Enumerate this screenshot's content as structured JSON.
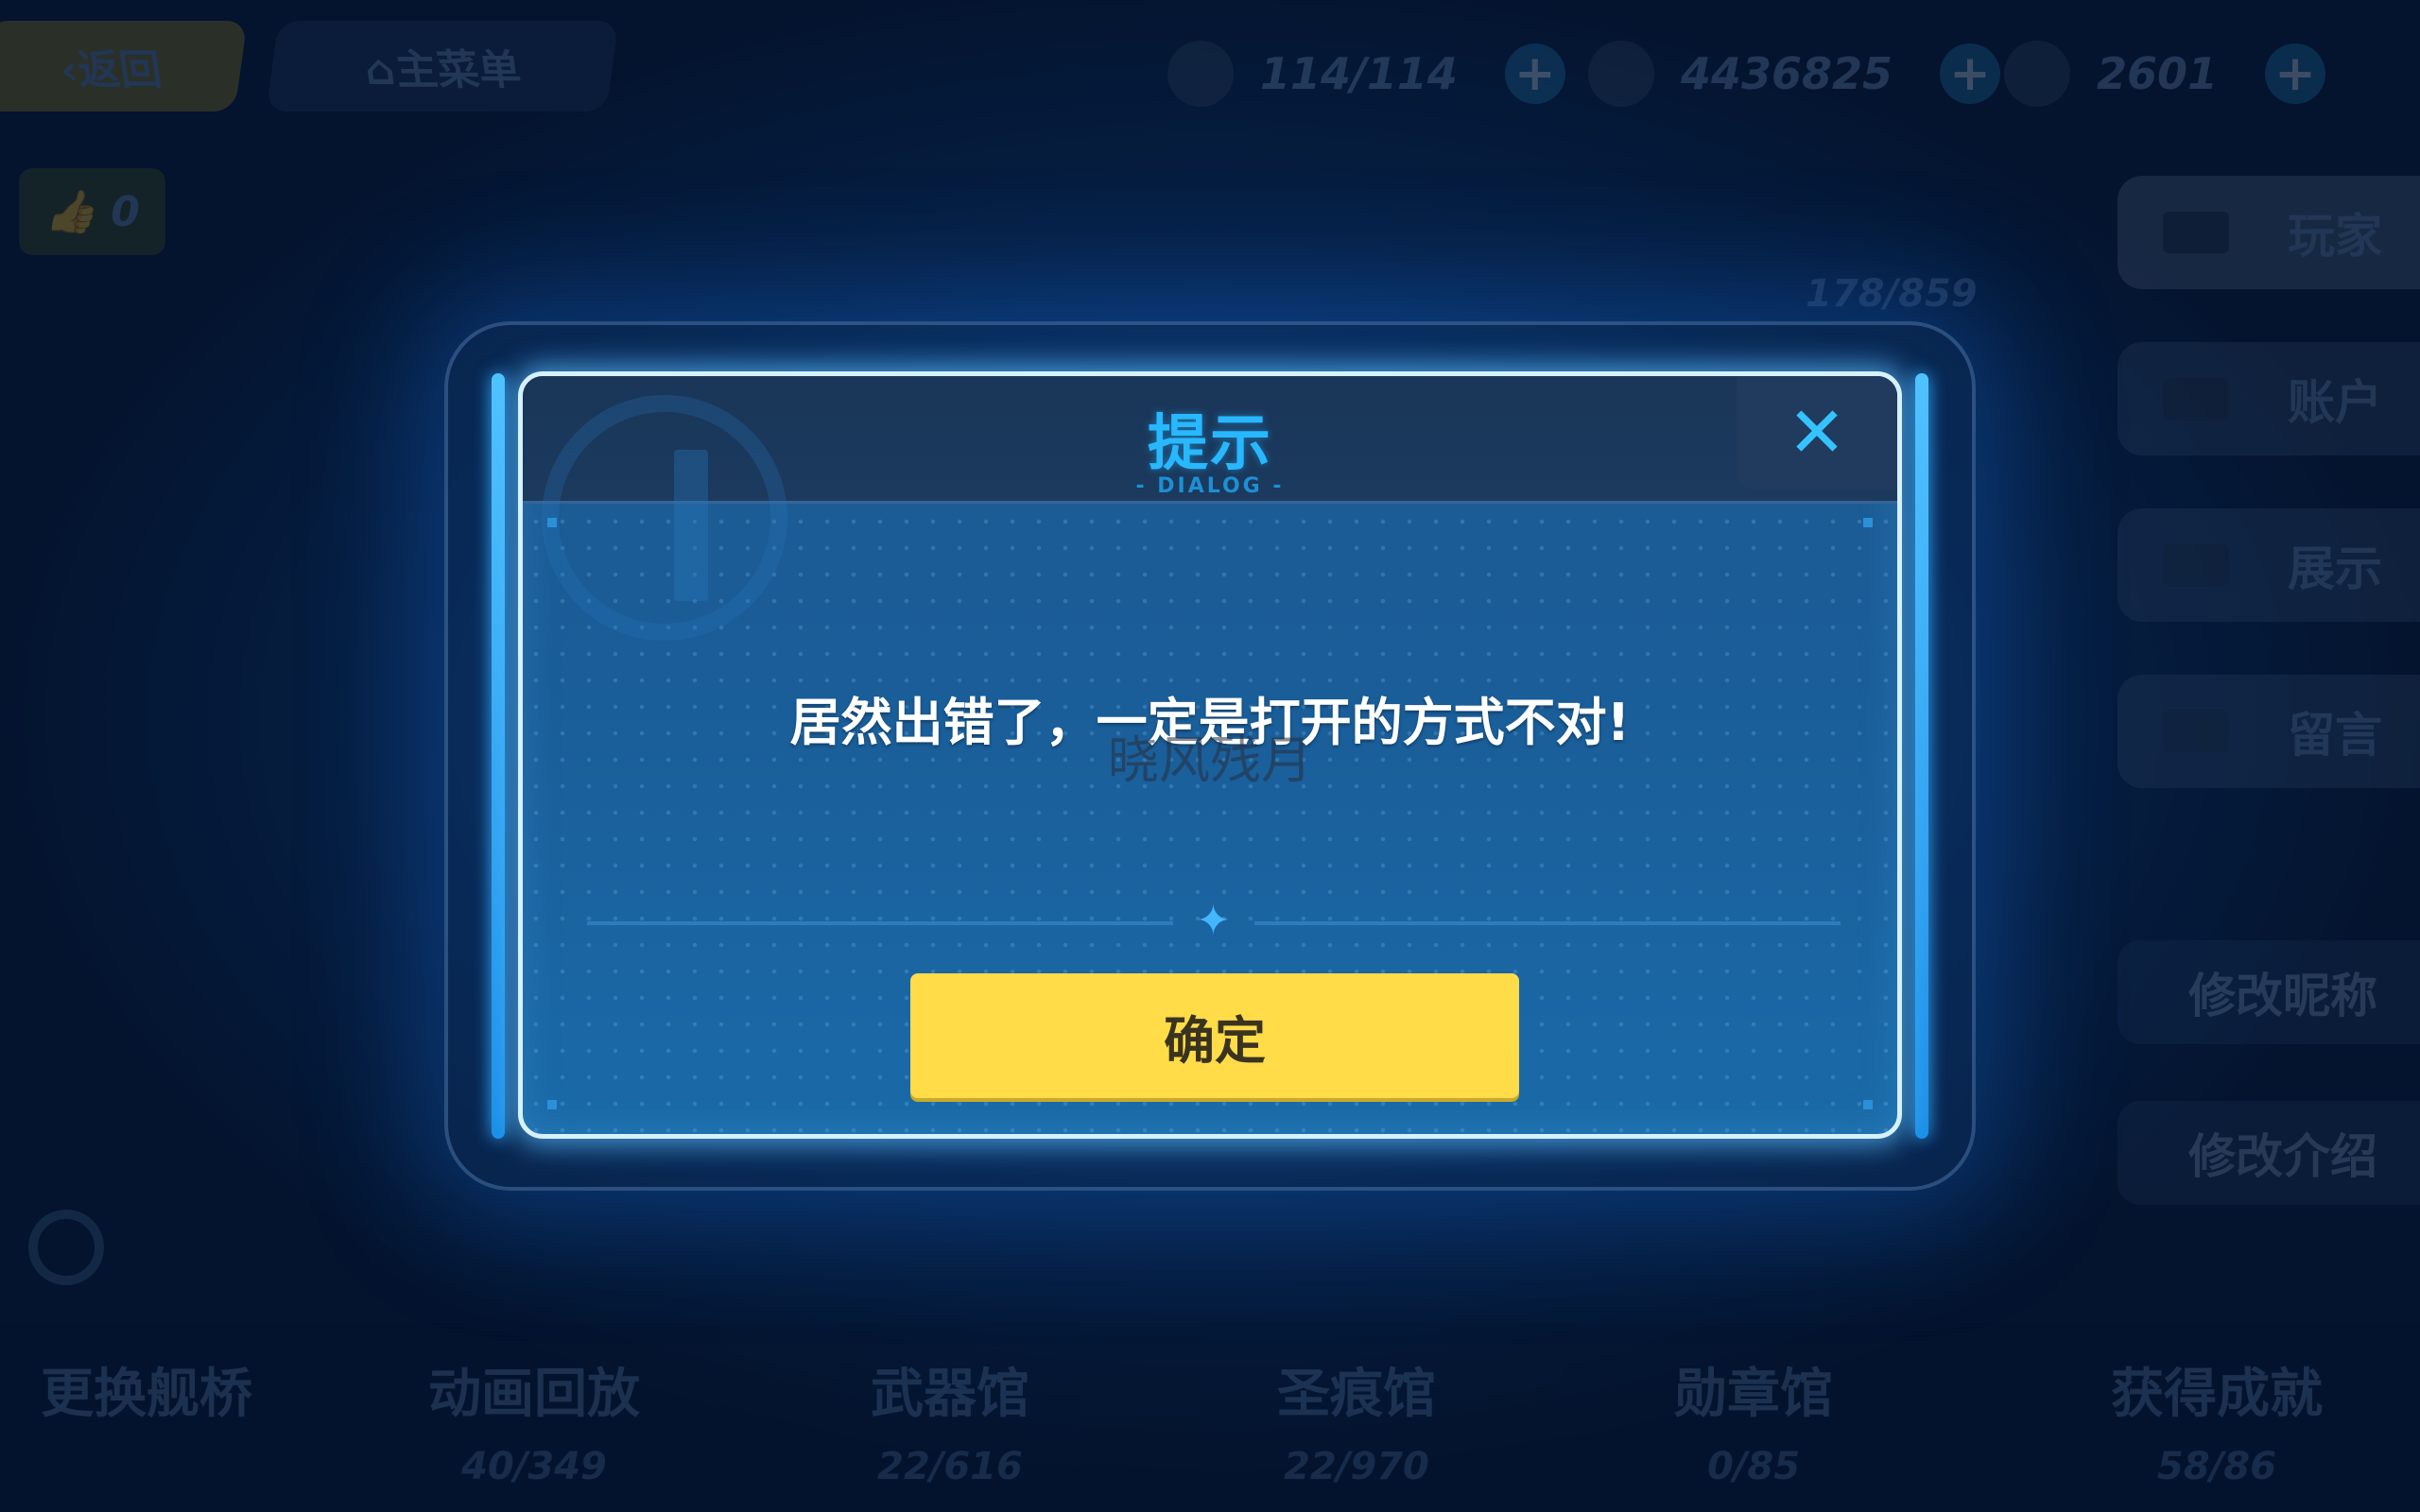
{
  "header": {
    "back_label": "返回",
    "home_label": "主菜单",
    "stamina": "114/114",
    "coins": "4436825",
    "crystals": "2601"
  },
  "like_count": "0",
  "right_panel": {
    "tabs": [
      {
        "label": "玩家",
        "icon": "id-card-icon"
      },
      {
        "label": "账户",
        "icon": "account-icon"
      },
      {
        "label": "展示",
        "icon": "display-icon"
      },
      {
        "label": "留言",
        "icon": "message-icon"
      }
    ],
    "edit_nickname": "修改昵称",
    "edit_intro": "修改介绍"
  },
  "progress_counter": "178/859",
  "bottom_nav": [
    {
      "label": "更换舰桥",
      "count": ""
    },
    {
      "label": "动画回放",
      "count": "40/349"
    },
    {
      "label": "武器馆",
      "count": "22/616"
    },
    {
      "label": "圣痕馆",
      "count": "22/970"
    },
    {
      "label": "勋章馆",
      "count": "0/85"
    },
    {
      "label": "获得成就",
      "count": "58/86"
    }
  ],
  "dialog": {
    "title": "提示",
    "subtitle": "- DIALOG -",
    "message": "居然出错了，一定是打开的方式不对!",
    "watermark": "晓风残月",
    "confirm_label": "确定",
    "close_icon": "close-icon",
    "accent_color": "#27b8ff",
    "button_color": "#ffdc48"
  }
}
